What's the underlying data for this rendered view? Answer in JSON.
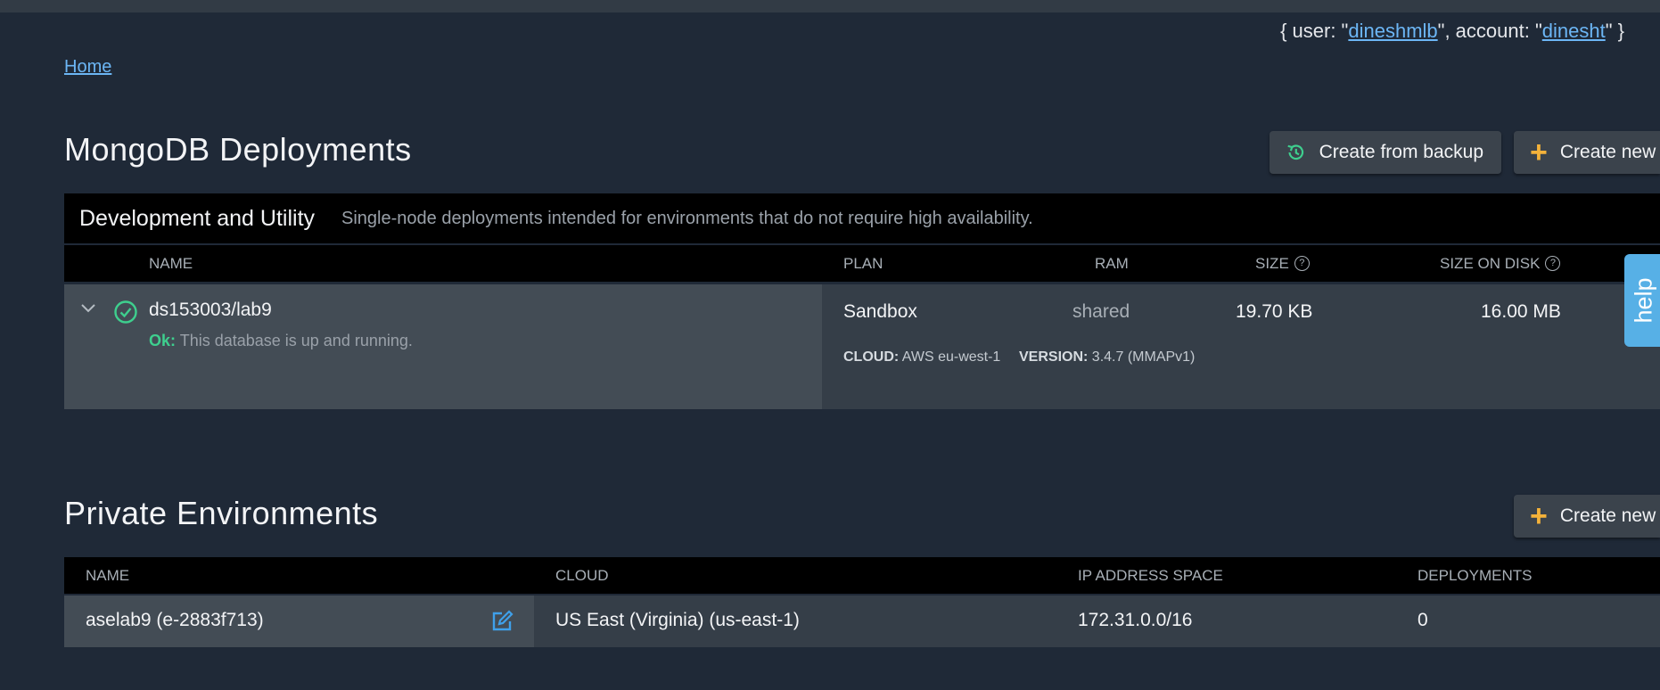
{
  "user_info": {
    "prefix": "{ user: \"",
    "user": "dineshmlb",
    "middle": "\", account: \"",
    "account": "dinesht",
    "suffix": "\" }"
  },
  "breadcrumb": {
    "home": "Home"
  },
  "deployments": {
    "title": "MongoDB Deployments",
    "create_from_backup_label": "Create from backup",
    "create_new_label": "Create new",
    "group": {
      "title": "Development and Utility",
      "description": "Single-node deployments intended for environments that do not require high availability."
    },
    "columns": {
      "name": "NAME",
      "plan": "PLAN",
      "ram": "RAM",
      "size": "SIZE",
      "size_on_disk": "SIZE ON DISK"
    },
    "rows": [
      {
        "name": "ds153003/lab9",
        "status_label": "Ok:",
        "status_text": "This database is up and running.",
        "plan": "Sandbox",
        "ram": "shared",
        "size": "19.70 KB",
        "size_on_disk": "16.00 MB",
        "cloud_label": "CLOUD:",
        "cloud_value": "AWS eu-west-1",
        "version_label": "VERSION:",
        "version_value": "3.4.7 (MMAPv1)"
      }
    ]
  },
  "private_envs": {
    "title": "Private Environments",
    "create_new_label": "Create new",
    "columns": {
      "name": "NAME",
      "cloud": "CLOUD",
      "ip": "IP ADDRESS SPACE",
      "deployments": "DEPLOYMENTS"
    },
    "rows": [
      {
        "name": "aselab9 (e-2883f713)",
        "cloud": "US East (Virginia) (us-east-1)",
        "ip": "172.31.0.0/16",
        "deployments": "0"
      }
    ]
  },
  "help_tab": {
    "label": "help"
  },
  "colors": {
    "background": "#1f2937",
    "link": "#6cb6f5",
    "ok_green": "#3ecf8e",
    "plus_orange": "#f4b23a",
    "help_blue": "#57b0e6"
  },
  "icons": [
    "restore-icon",
    "plus-icon",
    "chevron-down-icon",
    "check-circle-icon",
    "question-icon",
    "edit-icon"
  ]
}
